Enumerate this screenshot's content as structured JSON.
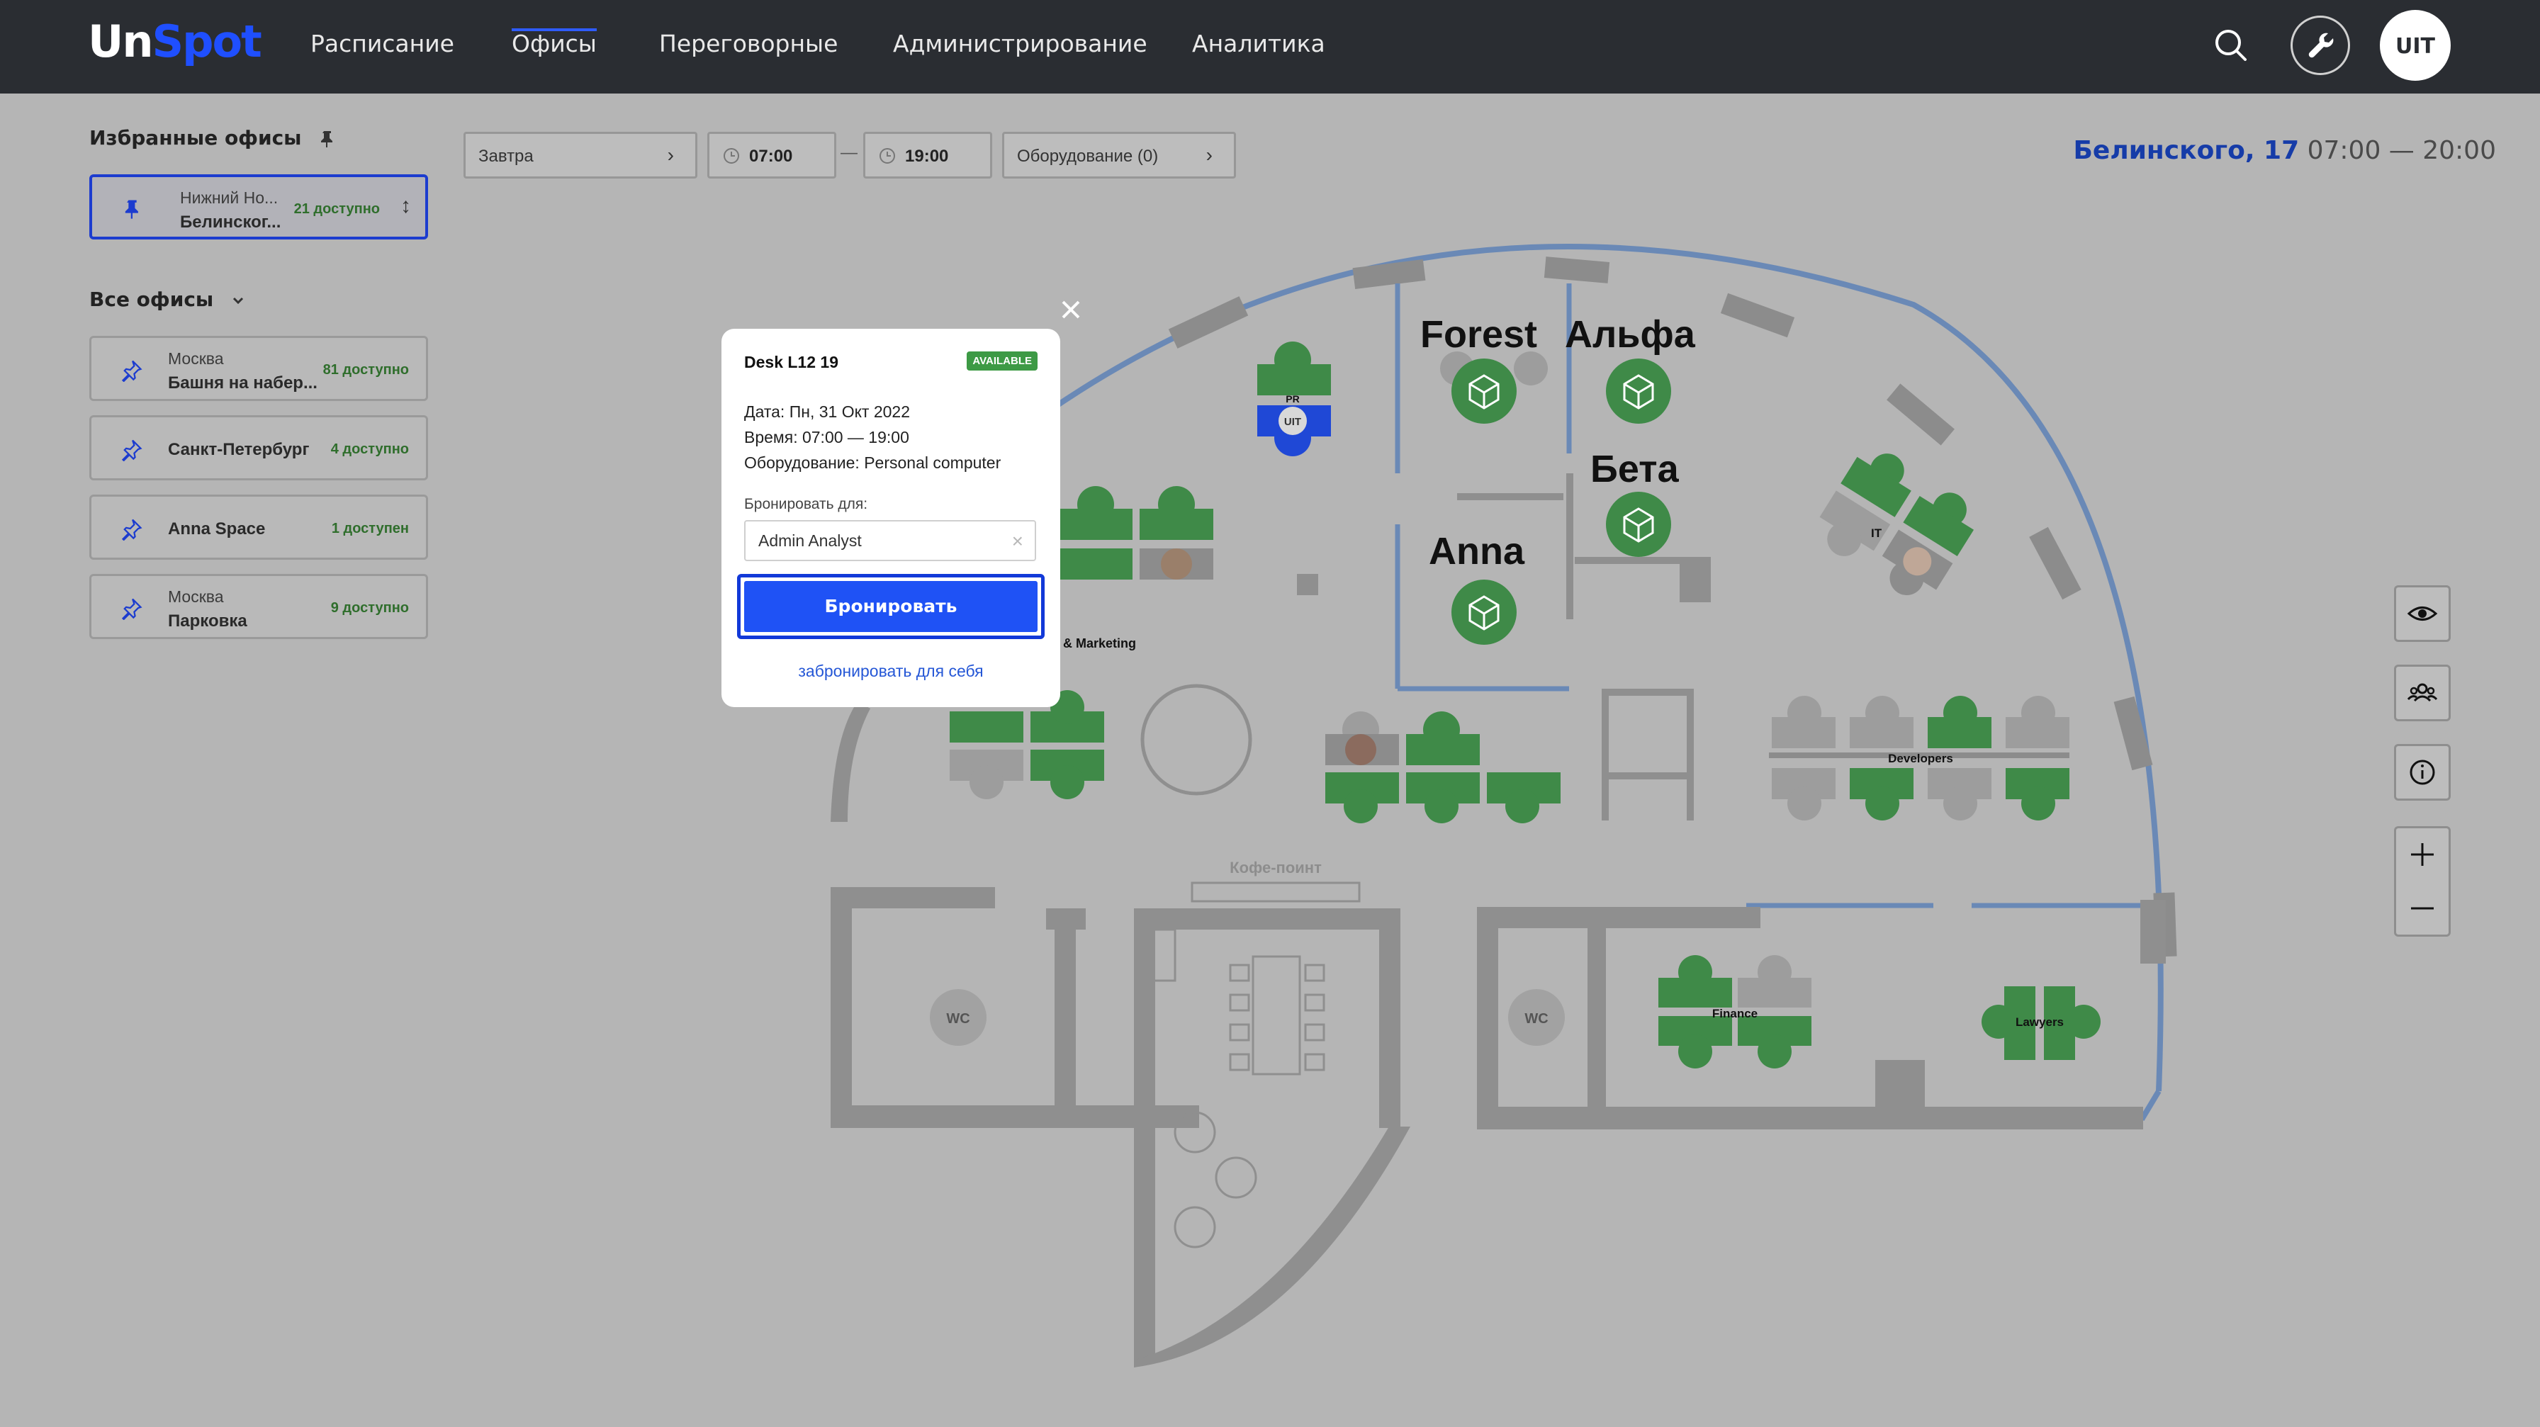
{
  "header": {
    "logo_un": "Un",
    "logo_spot": "Spot",
    "nav": [
      "Расписание",
      "Офисы",
      "Переговорные",
      "Администрирование",
      "Аналитика"
    ],
    "active_nav": "Офисы",
    "avatar_text": "UIT",
    "icons": [
      "search-icon",
      "wrench-icon",
      "avatar"
    ]
  },
  "sidebar": {
    "favorites_title": "Избранные офисы",
    "favorites": [
      {
        "city": "Нижний Но...",
        "name": "Белинског...",
        "available": "21 доступно"
      }
    ],
    "all_title": "Все офисы",
    "offices": [
      {
        "city": "Москва",
        "name": "Башня на набер...",
        "available": "81 доступно"
      },
      {
        "city": "",
        "name": "Санкт-Петербург",
        "available": "4 доступно"
      },
      {
        "city": "",
        "name": "Anna Space",
        "available": "1 доступен"
      },
      {
        "city": "Москва",
        "name": "Парковка",
        "available": "9 доступно"
      }
    ]
  },
  "filters": {
    "date": "Завтра",
    "time_from": "07:00",
    "time_sep": "—",
    "time_to": "19:00",
    "equipment": "Оборудование (0)"
  },
  "office_header": {
    "name": "Белинского, 17",
    "hours": "07:00 — 20:00"
  },
  "floor_plan": {
    "rooms": [
      "Forest",
      "Альфа",
      "Бета",
      "Anna"
    ],
    "zones": [
      "PR",
      "& Marketing",
      "IT",
      "Developers",
      "Finance",
      "Lawyers",
      "Кофе-поинт",
      "WC",
      "WC"
    ],
    "desk_badge": "UIT"
  },
  "popup": {
    "title": "Desk L12 19",
    "status": "AVAILABLE",
    "date_line": "Дата: Пн, 31 Окт 2022",
    "time_line": "Время: 07:00 — 19:00",
    "equipment_line": "Оборудование: Personal computer",
    "book_for_label": "Бронировать для:",
    "book_for_value": "Admin Analyst",
    "book_button": "Бронировать",
    "book_self_link": "забронировать для себя"
  },
  "colors": {
    "accent": "#1f52f5",
    "available_desk": "#3f8a48",
    "available_badge": "#3d9a45",
    "topbar": "#2a2d32"
  }
}
